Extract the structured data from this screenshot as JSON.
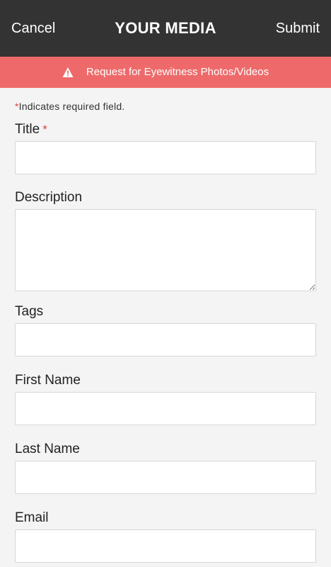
{
  "header": {
    "cancel_label": "Cancel",
    "title": "YOUR MEDIA",
    "submit_label": "Submit"
  },
  "alert": {
    "icon": "warning-icon",
    "text": "Request for Eyewitness Photos/Videos"
  },
  "form": {
    "required_note_star": "*",
    "required_note": "Indicates required field.",
    "fields": [
      {
        "label": "Title",
        "required_star": "*",
        "value": ""
      },
      {
        "label": "Description",
        "value": ""
      },
      {
        "label": "Tags",
        "value": ""
      },
      {
        "label": "First Name",
        "value": ""
      },
      {
        "label": "Last Name",
        "value": ""
      },
      {
        "label": "Email",
        "value": ""
      }
    ]
  },
  "colors": {
    "header_bg": "#333333",
    "alert_bg": "#ee6a6a",
    "required_star": "#e0463f",
    "page_bg": "#f4f4f4"
  }
}
